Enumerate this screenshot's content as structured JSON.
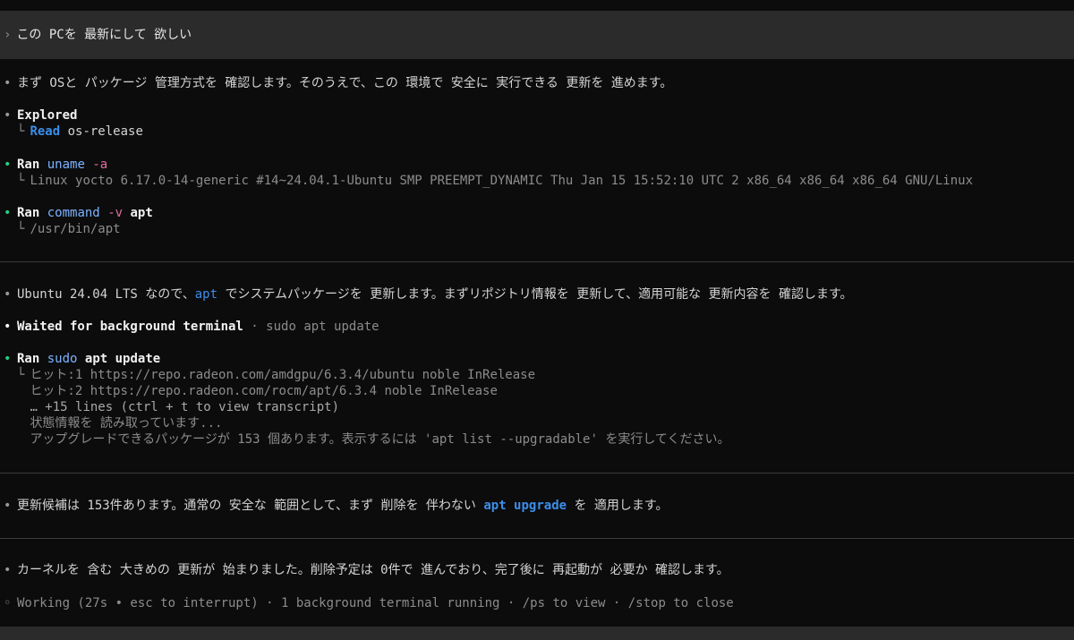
{
  "prompt": {
    "text": "この PCを 最新にして 欲しい"
  },
  "intro": {
    "text": "まず OSと パッケージ 管理方式を 確認します。そのうえで、この 環境で 安全に 実行できる 更新を 進めます。"
  },
  "explored": {
    "title": "Explored",
    "verb": "Read",
    "target": "os-release"
  },
  "ran_uname": {
    "label": "Ran",
    "cmd": "uname",
    "flag": "-a",
    "output": "Linux yocto 6.17.0-14-generic #14~24.04.1-Ubuntu SMP PREEMPT_DYNAMIC Thu Jan 15 15:52:10 UTC 2 x86_64 x86_64 x86_64 GNU/Linux"
  },
  "ran_command": {
    "label": "Ran",
    "cmd": "command",
    "flag": "-v",
    "arg": "apt",
    "output": "/usr/bin/apt"
  },
  "ubuntu_msg": {
    "pre": "Ubuntu 24.04 LTS なので、",
    "code": "apt",
    "post": " でシステムパッケージを 更新します。まずリポジトリ情報を 更新して、適用可能な 更新内容を 確認します。"
  },
  "waited": {
    "title": "Waited for background terminal",
    "sep": " · ",
    "cmd": "sudo apt update"
  },
  "ran_update": {
    "label": "Ran",
    "sudo": "sudo",
    "rest": "apt update",
    "lines": [
      "ヒット:1 https://repo.radeon.com/amdgpu/6.3.4/ubuntu noble InRelease",
      "ヒット:2 https://repo.radeon.com/rocm/apt/6.3.4 noble InRelease",
      "… +15 lines (ctrl + t to view transcript)",
      "状態情報を 読み取っています...",
      "アップグレードできるパッケージが  153 個あります。表示するには  'apt list --upgradable' を実行してください。"
    ]
  },
  "candidates": {
    "pre": "更新候補は 153件あります。通常の 安全な 範囲として、まず 削除を 伴わない  ",
    "code": "apt upgrade",
    "post": " を 適用します。"
  },
  "kernel": {
    "text": "カーネルを 含む 大きめの 更新が 始まりました。削除予定は 0件で 進んでおり、完了後に 再起動が 必要か 確認します。"
  },
  "status": {
    "text": "Working (27s • esc to interrupt) · 1 background terminal running · /ps to view · /stop to close"
  }
}
